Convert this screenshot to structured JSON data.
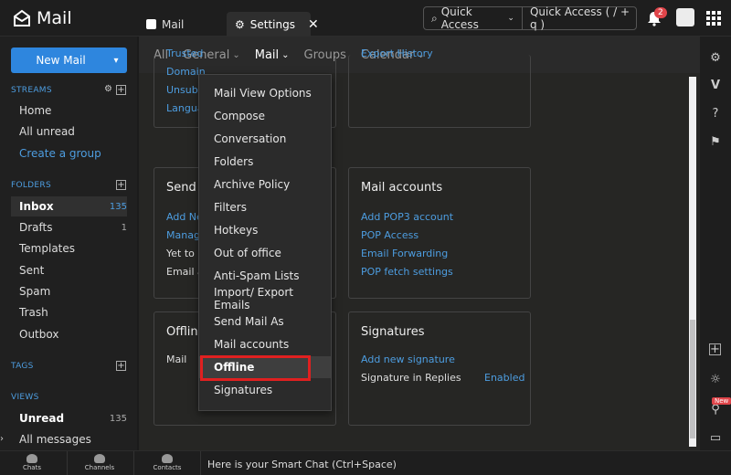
{
  "app": {
    "title": "Mail"
  },
  "tabs": {
    "mail": "Mail",
    "settings": "Settings",
    "close": "✕"
  },
  "search": {
    "scope": "Quick Access",
    "placeholder": "Quick Access  ( / + q )"
  },
  "notifications": {
    "count": "2"
  },
  "sidebar": {
    "new_mail": "New Mail",
    "streams": {
      "heading": "STREAMS",
      "items": [
        {
          "label": "Home"
        },
        {
          "label": "All unread"
        },
        {
          "label": "Create a group"
        }
      ]
    },
    "folders": {
      "heading": "FOLDERS",
      "items": [
        {
          "label": "Inbox",
          "count": "135"
        },
        {
          "label": "Drafts",
          "count": "1"
        },
        {
          "label": "Templates",
          "count": ""
        },
        {
          "label": "Sent",
          "count": ""
        },
        {
          "label": "Spam",
          "count": ""
        },
        {
          "label": "Trash",
          "count": ""
        },
        {
          "label": "Outbox",
          "count": ""
        }
      ]
    },
    "tags": {
      "heading": "TAGS"
    },
    "views": {
      "heading": "VIEWS",
      "items": [
        {
          "label": "Unread",
          "count": "135"
        },
        {
          "label": "All messages",
          "count": ""
        }
      ]
    }
  },
  "settings_nav": {
    "items": [
      "All",
      "General",
      "Mail",
      "Groups",
      "Calendar"
    ],
    "active": "Mail"
  },
  "cards": {
    "top_left": {
      "rows": [
        "Trusted",
        "Domain",
        "Unsubs",
        "Langua"
      ]
    },
    "top_right": {
      "rows": [
        "Export History"
      ]
    },
    "send_mail": {
      "title": "Send M",
      "rows": [
        "Add Ne",
        "Manage",
        "Yet to b",
        "Email al"
      ]
    },
    "mail_accounts": {
      "title": "Mail accounts",
      "rows": [
        "Add POP3 account",
        "POP Access",
        "Email Forwarding",
        "POP fetch settings"
      ]
    },
    "offline": {
      "title": "Offline",
      "rows": [
        "Mail"
      ]
    },
    "signatures": {
      "title": "Signatures",
      "rows": [
        "Add new signature",
        "Signature in Replies"
      ],
      "enabled": "Enabled"
    }
  },
  "dropdown": {
    "items": [
      "Mail View Options",
      "Compose",
      "Conversation",
      "Folders",
      "Archive Policy",
      "Filters",
      "Hotkeys",
      "Out of office",
      "Anti-Spam Lists",
      "Import/ Export Emails",
      "Send Mail As",
      "Mail accounts",
      "Offline",
      "Signatures"
    ],
    "highlighted": "Offline"
  },
  "right_rail": {
    "new_badge": "New"
  },
  "bottom": {
    "chats": "Chats",
    "channels": "Channels",
    "contacts": "Contacts",
    "smart_chat": "Here is your Smart Chat (Ctrl+Space)"
  },
  "colors": {
    "accent": "#2e86de",
    "link": "#4d9de0",
    "highlight_box": "#e02020",
    "badge": "#e0454a"
  }
}
